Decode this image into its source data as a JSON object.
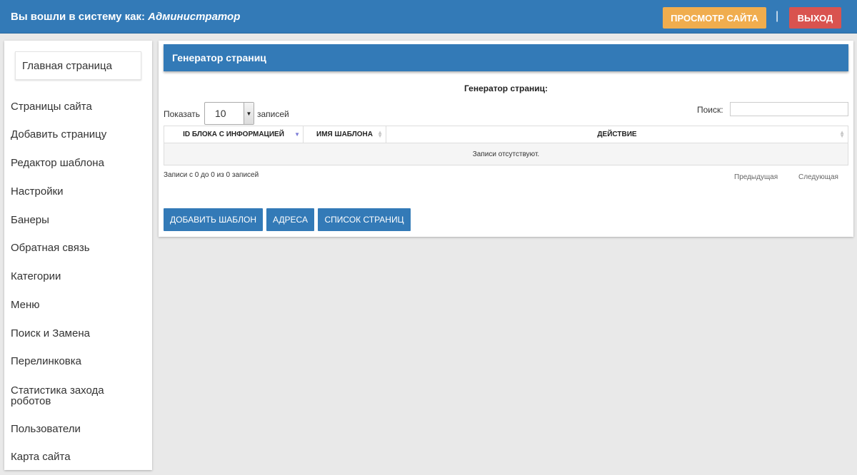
{
  "header": {
    "logged_in_prefix": "Вы вошли в систему как:",
    "user_role": "Администратор",
    "view_site_label": "ПРОСМОТР САЙТА",
    "separator": "|",
    "logout_label": "ВЫХОД",
    "colors": {
      "bar": "#337ab7",
      "view_site": "#f0ad4e",
      "logout": "#d9534f"
    }
  },
  "sidebar": {
    "home_label": "Главная страница",
    "items": [
      {
        "label": "Страницы сайта"
      },
      {
        "label": "Добавить страницу"
      },
      {
        "label": "Редактор шаблона"
      },
      {
        "label": "Настройки"
      },
      {
        "label": "Банеры"
      },
      {
        "label": "Обратная связь"
      },
      {
        "label": "Категории"
      },
      {
        "label": "Меню"
      },
      {
        "label": "Поиск и Замена"
      },
      {
        "label": "Перелинковка"
      },
      {
        "label": "Статистика захода роботов"
      },
      {
        "label": "Пользователи"
      },
      {
        "label": "Карта сайта"
      }
    ]
  },
  "main": {
    "panel_title": "Генератор страниц",
    "subtitle": "Генератор страниц:",
    "length": {
      "show_label": "Показать",
      "value": "10",
      "records_label": "записей"
    },
    "search": {
      "label": "Поиск:",
      "value": ""
    },
    "table": {
      "columns": [
        "ID БЛОКА С ИНФОРМАЦИЕЙ",
        "ИМЯ ШАБЛОНА",
        "ДЕЙСТВИЕ"
      ],
      "sorted_column": 0,
      "empty_text": "Записи отсутствуют."
    },
    "info_text": "Записи с 0 до 0 из 0 записей",
    "pagination": {
      "previous": "Предыдущая",
      "next": "Следующая"
    },
    "actions": {
      "add_template": "ДОБАВИТЬ ШАБЛОН",
      "addresses": "АДРЕСА",
      "page_list": "СПИСОК СТРАНИЦ"
    }
  }
}
